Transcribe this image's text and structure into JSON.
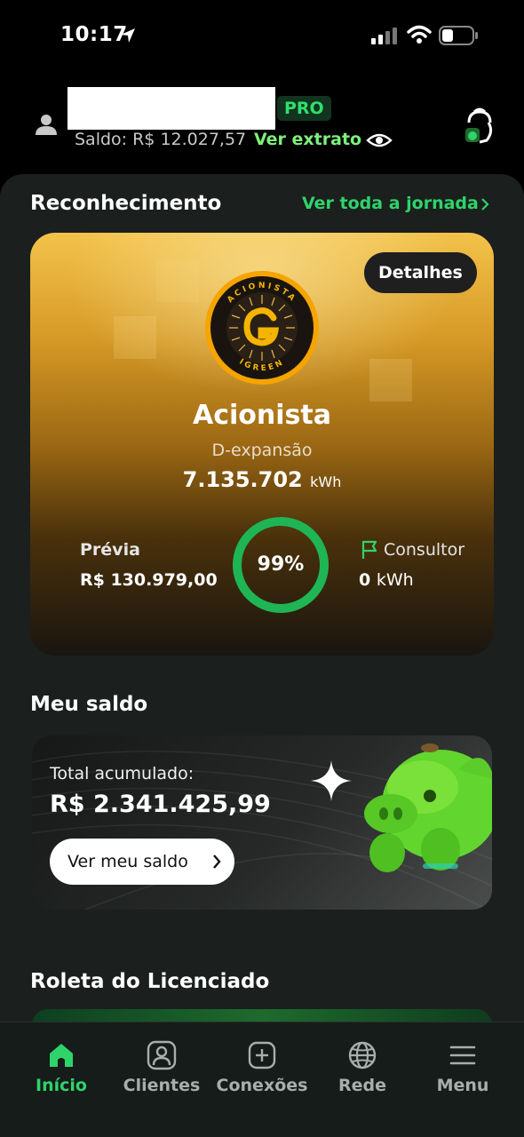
{
  "status_bar": {
    "time": "10:17"
  },
  "header": {
    "plan_badge": "PRO",
    "balance_label": "Saldo: R$ 12.027,57",
    "statement_link": "Ver extrato"
  },
  "recognition": {
    "section_title": "Reconhecimento",
    "journey_link": "Ver toda a jornada",
    "details_button": "Detalhes",
    "badge_text_top": "ACIONISTA",
    "badge_text_bottom": "IGREEN",
    "level_name": "Acionista",
    "level_subtitle": "D-expansão",
    "energy_value": "7.135.702",
    "energy_unit": "kWh",
    "preview_label": "Prévia",
    "preview_value": "R$ 130.979,00",
    "progress_label": "99%",
    "progress_fraction": 0.99,
    "next_level_label": "Consultor",
    "next_level_value": "0",
    "next_level_unit": "kWh"
  },
  "balance": {
    "section_title": "Meu saldo",
    "total_label": "Total acumulado:",
    "total_value": "R$ 2.341.425,99",
    "button_label": "Ver meu saldo"
  },
  "roulette": {
    "section_title": "Roleta do Licenciado"
  },
  "bottom_nav": {
    "items": [
      {
        "label": "Início",
        "icon": "home-icon",
        "active": true
      },
      {
        "label": "Clientes",
        "icon": "clients-icon",
        "active": false
      },
      {
        "label": "Conexões",
        "icon": "connections-icon",
        "active": false
      },
      {
        "label": "Rede",
        "icon": "globe-icon",
        "active": false
      },
      {
        "label": "Menu",
        "icon": "menu-icon",
        "active": false
      }
    ]
  },
  "colors": {
    "accent_green": "#2fd36a",
    "link_green": "#7ef07a",
    "panel_bg": "#1b1f1e",
    "nav_bg": "#151c1a",
    "gold": "#e1a92f"
  }
}
